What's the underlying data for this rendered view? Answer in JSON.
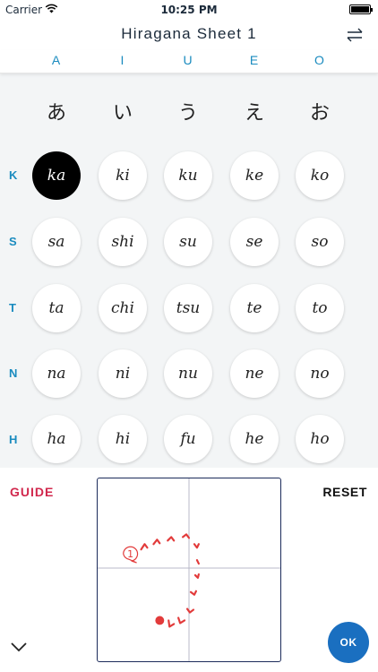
{
  "status_bar": {
    "carrier": "Carrier",
    "time": "10:25 PM"
  },
  "nav": {
    "title": "Hiragana Sheet 1",
    "swap_icon": "swap-arrows-icon"
  },
  "vowels": [
    "A",
    "I",
    "U",
    "E",
    "O"
  ],
  "kana_header": [
    "あ",
    "い",
    "う",
    "え",
    "お"
  ],
  "rows": [
    {
      "label": "K",
      "cells": [
        "ka",
        "ki",
        "ku",
        "ke",
        "ko"
      ]
    },
    {
      "label": "S",
      "cells": [
        "sa",
        "shi",
        "su",
        "se",
        "so"
      ]
    },
    {
      "label": "T",
      "cells": [
        "ta",
        "chi",
        "tsu",
        "te",
        "to"
      ]
    },
    {
      "label": "N",
      "cells": [
        "na",
        "ni",
        "nu",
        "ne",
        "no"
      ]
    },
    {
      "label": "H",
      "cells": [
        "ha",
        "hi",
        "fu",
        "he",
        "ho"
      ]
    }
  ],
  "selected_cell": "ka",
  "bottom": {
    "guide_label": "GUIDE",
    "reset_label": "RESET",
    "ok_label": "OK",
    "stroke_number": "1",
    "collapse_icon": "chevron-down-icon"
  },
  "colors": {
    "accent_blue": "#1a8bbf",
    "guide_red": "#d1284d",
    "ok_blue": "#1a6fc0",
    "stroke_red": "#e23b3b",
    "selected_cell": "#000000"
  }
}
